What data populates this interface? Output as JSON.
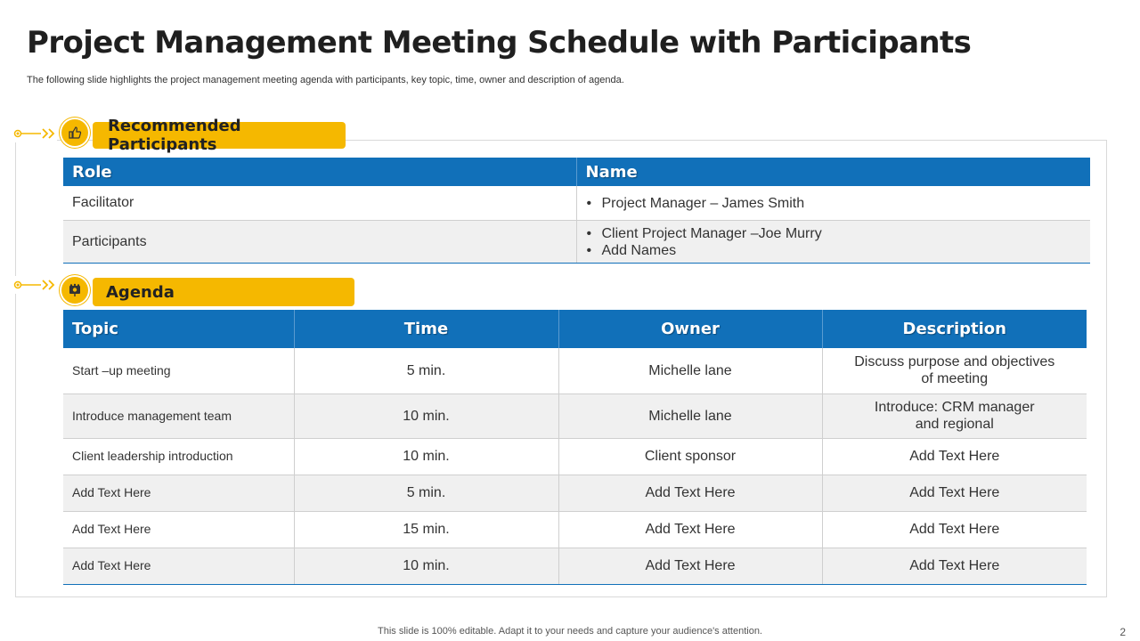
{
  "slide": {
    "title": "Project Management Meeting Schedule with Participants",
    "subtitle": "The following slide highlights the project management meeting agenda with participants, key topic, time, owner and description of agenda.",
    "footer": "This slide is 100% editable. Adapt it to your needs and capture your audience's attention.",
    "page_number": "2",
    "colors": {
      "accent_yellow": "#f5b800",
      "header_blue": "#1170b9",
      "row_alt": "#f0f0f0"
    }
  },
  "participants": {
    "section_label": "Recommended Participants",
    "icon": "thumbs-up-icon",
    "headers": [
      "Role",
      "Name"
    ],
    "rows": [
      {
        "role": "Facilitator",
        "names": [
          "Project Manager – James Smith"
        ]
      },
      {
        "role": "Participants",
        "names": [
          "Client Project Manager –Joe Murry",
          "Add Names"
        ]
      }
    ]
  },
  "agenda": {
    "section_label": "Agenda",
    "icon": "meeting-board-icon",
    "headers": [
      "Topic",
      "Time",
      "Owner",
      "Description"
    ],
    "rows": [
      {
        "topic": "Start –up meeting",
        "time": "5 min.",
        "owner": "Michelle lane",
        "description": [
          "Discuss purpose and objectives",
          "of meeting"
        ]
      },
      {
        "topic": "Introduce management team",
        "time": "10 min.",
        "owner": "Michelle lane",
        "description": [
          "Introduce:  CRM manager",
          "and regional"
        ]
      },
      {
        "topic": "Client leadership introduction",
        "time": "10 min.",
        "owner": "Client sponsor",
        "description": [
          "Add Text Here"
        ]
      },
      {
        "topic": "Add Text Here",
        "time": "5 min.",
        "owner": "Add Text Here",
        "description": [
          "Add Text Here"
        ]
      },
      {
        "topic": "Add Text Here",
        "time": "15 min.",
        "owner": "Add Text Here",
        "description": [
          "Add Text Here"
        ]
      },
      {
        "topic": "Add Text Here",
        "time": "10 min.",
        "owner": "Add Text Here",
        "description": [
          "Add Text Here"
        ]
      }
    ]
  }
}
